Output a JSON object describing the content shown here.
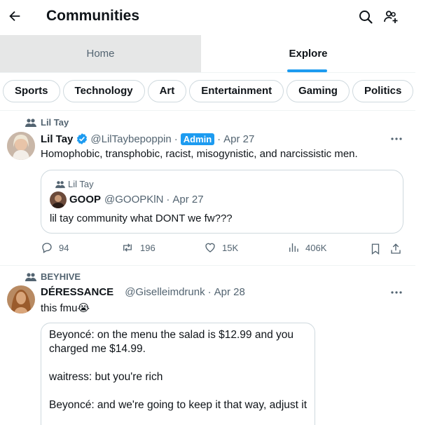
{
  "header": {
    "title": "Communities"
  },
  "tabs": [
    {
      "label": "Home"
    },
    {
      "label": "Explore"
    }
  ],
  "chips": [
    "Sports",
    "Technology",
    "Art",
    "Entertainment",
    "Gaming",
    "Politics"
  ],
  "posts": [
    {
      "community": "Lil Tay",
      "name": "Lil Tay",
      "handle": "@LilTaybepoppin",
      "badge": "Admin",
      "date": "Apr 27",
      "text": "Homophobic, transphobic, racist, misogynistic, and narcissistic men.",
      "quote": {
        "community": "Lil Tay",
        "name": "GOOP",
        "handle": "@GOOPKlN",
        "date": "Apr 27",
        "text": "lil tay community what DONT we fw???"
      },
      "stats": {
        "replies": "94",
        "reposts": "196",
        "likes": "15K",
        "views": "406K"
      }
    },
    {
      "community": "BEYHIVE",
      "name": "DÉRESSANCE",
      "handle": "@Giselleimdrunk",
      "date": "Apr 28",
      "text": "this fmu😭",
      "media_lines": [
        "Beyoncé: on the menu the salad is $12.99 and you charged me $14.99.",
        "waitress: but you're rich",
        "Beyoncé: and we're going to keep it that way, adjust it"
      ]
    }
  ],
  "colors": {
    "accent": "#1d9bf0",
    "secondary_text": "#536471",
    "border": "#cfd9de"
  }
}
